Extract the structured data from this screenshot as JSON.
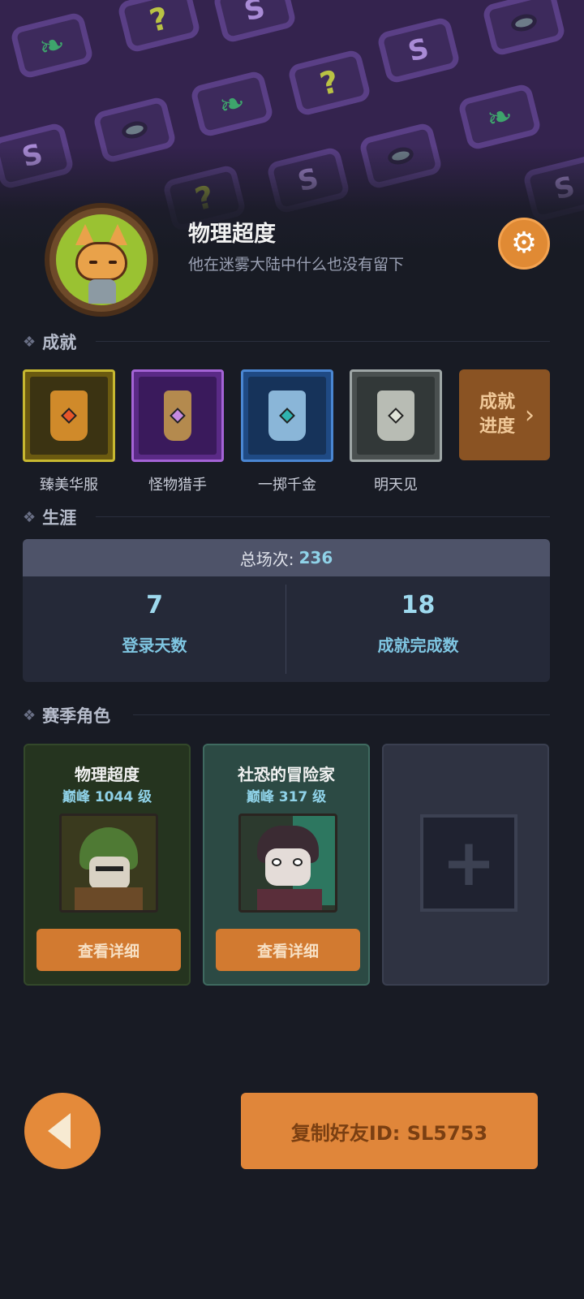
{
  "profile": {
    "nickname": "物理超度",
    "signature": "他在迷雾大陆中什么也没有留下"
  },
  "icons": {
    "settings": "gear-icon",
    "back": "back-arrow-icon",
    "section": "diamond-icon",
    "progress": "chevron-right-icon",
    "add": "plus-icon"
  },
  "achievements": {
    "title": "成就",
    "items": [
      {
        "label": "臻美华服",
        "tier": "gold"
      },
      {
        "label": "怪物猎手",
        "tier": "purple"
      },
      {
        "label": "一掷千金",
        "tier": "blue"
      },
      {
        "label": "明天见",
        "tier": "silver"
      }
    ],
    "progress_label": "成就进度"
  },
  "career": {
    "title": "生涯",
    "total_label": "总场次:",
    "total_value": "236",
    "stats": [
      {
        "value": "7",
        "label": "登录天数"
      },
      {
        "value": "18",
        "label": "成就完成数"
      }
    ]
  },
  "season_roles": {
    "title": "赛季角色",
    "roles": [
      {
        "name": "物理超度",
        "level": "巅峰 1044 级",
        "button": "查看详细"
      },
      {
        "name": "社恐的冒险家",
        "level": "巅峰 317 级",
        "button": "查看详细"
      }
    ]
  },
  "footer": {
    "copy_label": "复制好友ID: SL5753"
  },
  "colors": {
    "background": "#181b24",
    "accent_orange": "#e0863a",
    "stat_blue": "#8fd2e8",
    "banner_purple": "#34234e"
  }
}
